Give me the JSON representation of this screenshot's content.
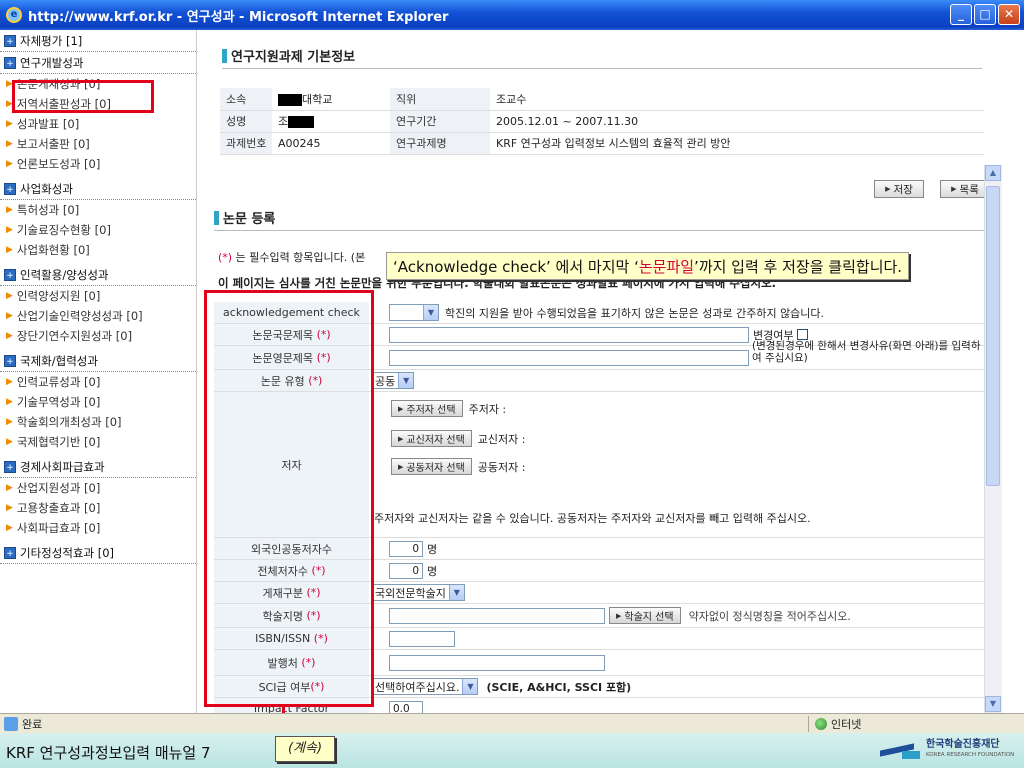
{
  "window": {
    "title": "http://www.krf.or.kr - 연구성과 - Microsoft Internet Explorer",
    "min": "_",
    "max": "□",
    "close": "✕"
  },
  "sidebar": {
    "sections": [
      {
        "label": "자체평가 [1]",
        "items": []
      },
      {
        "label": "연구개발성과",
        "items": [
          "논문게재성과 [0]",
          "저역서출판성과 [0]",
          "성과발표 [0]",
          "보고서출판 [0]",
          "언론보도성과 [0]"
        ]
      },
      {
        "label": "사업화성과",
        "items": [
          "특허성과 [0]",
          "기술료징수현황 [0]",
          "사업화현황 [0]"
        ]
      },
      {
        "label": "인력활용/양성성과",
        "items": [
          "인력양성지원 [0]",
          "산업기술인력양성성과 [0]",
          "장단기연수지원성과 [0]"
        ]
      },
      {
        "label": "국제화/협력성과",
        "items": [
          "인력교류성과 [0]",
          "기술무역성과 [0]",
          "학술회의개최성과 [0]",
          "국제협력기반 [0]"
        ]
      },
      {
        "label": "경제사회파급효과",
        "items": [
          "산업지원성과 [0]",
          "고용창출효과 [0]",
          "사회파급효과 [0]"
        ]
      },
      {
        "label": "기타정성적효과 [0]",
        "items": []
      }
    ]
  },
  "basic_info": {
    "title": "연구지원과제 기본정보",
    "rows": [
      {
        "l1": "소속",
        "v1": "대학교",
        "l2": "직위",
        "v2": "조교수"
      },
      {
        "l1": "성명",
        "v1": "조",
        "l2": "연구기간",
        "v2": "2005.12.01 ~ 2007.11.30"
      },
      {
        "l1": "과제번호",
        "v1": "A00245",
        "l2": "연구과제명",
        "v2": "KRF 연구성과 입력정보 시스템의 효율적 관리 방안"
      }
    ]
  },
  "buttons": {
    "save": "저장",
    "list": "목록"
  },
  "paper_form": {
    "title": "논문 등록",
    "req_star": "(*)",
    "req_note": "는 필수입력 항목입니다. (본",
    "page_note": "이 페이지는 심사를 거친 논문만을 위한 부분입니다. 학술대회 발표논문은 성과발표 페이지에 가서 입력해 주십시오.",
    "ack_label": "acknowledgement check",
    "ack_text": "학진의 지원을 받아 수행되었음을 표기하지 않은 논문은 성과로 간주하지 않습니다.",
    "title_kr_label": "논문국문제목",
    "title_en_label": "논문영문제목",
    "change_label": "변경여부",
    "change_note": "(변경된경우에 한해서 변경사유(화면 아래)를 입력하여 주십시요)",
    "type_label": "논문 유형",
    "type_value": "공동",
    "author_label": "저자",
    "btn_main_author": "주저자 선택",
    "main_author": "주저자 :",
    "btn_corr_author": "교신저자 선택",
    "corr_author": "교신저자 :",
    "btn_co_author": "공동저자 선택",
    "co_author": "공동저자 :",
    "author_note": "주저자와 교신저자는 같을 수 있습니다. 공동저자는 주저자와 교신저자를 빼고 입력해 주십시오.",
    "foreign_label": "외국인공동저자수",
    "foreign_value": "0",
    "total_label": "전체저자수",
    "total_value": "0",
    "unit_people": "명",
    "pub_type_label": "게재구분",
    "pub_type_value": "국외전문학술지",
    "journal_label": "학술지명",
    "btn_journal": "학술지 선택",
    "journal_note": "약자없이 정식명칭을 적어주십시오.",
    "isbn_label": "ISBN/ISSN",
    "publisher_label": "발행처",
    "sci_label": "SCI급 여부",
    "sci_value": "선택하여주십시요.",
    "sci_note": "(SCIE, A&HCI, SSCI 포함)",
    "if_label": "Impact Factor",
    "if_value": "0.0"
  },
  "callout": {
    "p1": "‘Acknowledge check’ 에서 마지막 ‘",
    "hl": "논문파일",
    "p2": "’까지 입력 후 저장을 클릭합니다."
  },
  "statusbar": {
    "done": "완료",
    "zone": "인터넷"
  },
  "footer": {
    "title": "KRF 연구성과정보입력 매뉴얼 7",
    "continued": "(계속)",
    "logo_ko": "한국학술진흥재단",
    "logo_en": "KOREA RESEARCH FOUNDATION"
  },
  "colors": {
    "accent_red": "#e3001b",
    "required_star": "#d2003c",
    "callout_bg": "#ffffc8"
  }
}
